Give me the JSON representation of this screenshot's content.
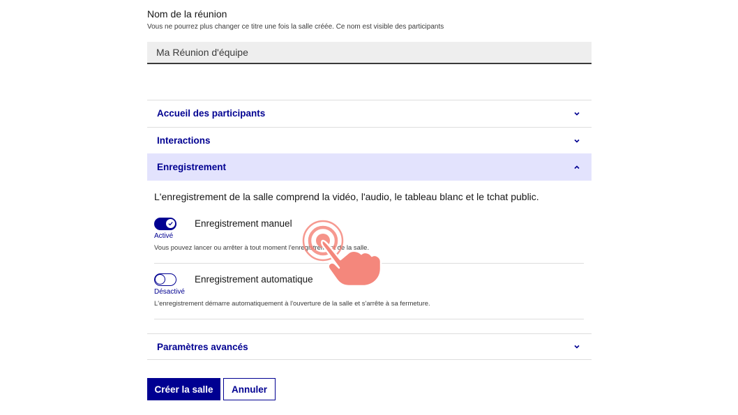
{
  "meeting_name": {
    "label": "Nom de la réunion",
    "hint": "Vous ne pourrez plus changer ce titre une fois la salle créée. Ce nom est visible des participants",
    "value": "Ma Réunion d'équipe"
  },
  "accordions": {
    "welcome": {
      "title": "Accueil des participants",
      "expanded": false
    },
    "interactions": {
      "title": "Interactions",
      "expanded": false
    },
    "recording": {
      "title": "Enregistrement",
      "expanded": true
    },
    "advanced": {
      "title": "Paramètres avancés",
      "expanded": false
    }
  },
  "recording": {
    "description": "L'enregistrement de la salle comprend la vidéo, l'audio, le tableau blanc et le tchat public.",
    "manual": {
      "label": "Enregistrement manuel",
      "state": "Activé",
      "on": true,
      "hint": "Vous pouvez lancer ou arrêter à tout moment l'enregistrement de la salle."
    },
    "automatic": {
      "label": "Enregistrement automatique",
      "state": "Désactivé",
      "on": false,
      "hint": "L'enregistrement démarre automatiquement à l'ouverture de la salle et s'arrête à sa fermeture."
    }
  },
  "actions": {
    "create_label": "Créer la salle",
    "cancel_label": "Annuler"
  },
  "colors": {
    "primary": "#000091",
    "accordion_open_bg": "#e3e3fd",
    "cursor": "#f4877c"
  },
  "icons": {
    "chevron_down": "chevron-down-icon",
    "chevron_up": "chevron-up-icon",
    "check": "check-icon",
    "cursor": "hand-pointer-icon"
  }
}
